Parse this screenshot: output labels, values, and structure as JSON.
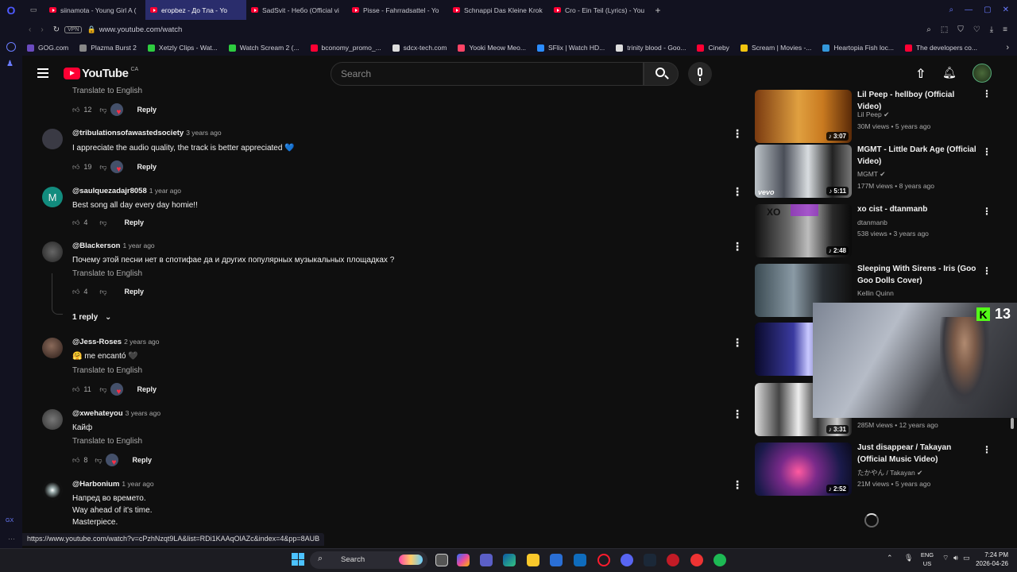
{
  "browser": {
    "tabs": [
      {
        "label": "siinamota - Young Girl A (",
        "active": false
      },
      {
        "label": "егорbez - До Тла - Yo",
        "active": true
      },
      {
        "label": "SadSvit - Небо (Official vi",
        "active": false
      },
      {
        "label": "Pisse - Fahrradsattel - Yo",
        "active": false
      },
      {
        "label": "Schnappi Das Kleine Krok",
        "active": false
      },
      {
        "label": "Cro - Ein Teil (Lyrics) - You",
        "active": false
      }
    ],
    "vpn": "VPN",
    "url": "www.youtube.com/watch",
    "bookmarks": [
      {
        "label": "GOG.com",
        "color": "#6b4bbf"
      },
      {
        "label": "Plazma Burst 2",
        "color": "#888"
      },
      {
        "label": "Xetzly Clips - Wat...",
        "color": "#2ecc40"
      },
      {
        "label": "Watch Scream 2 (...",
        "color": "#2ecc40"
      },
      {
        "label": "bconomy_promo_...",
        "color": "#ff0033"
      },
      {
        "label": "sdcx-tech.com",
        "color": "#ddd"
      },
      {
        "label": "Yooki Meow Meo...",
        "color": "#ff4466"
      },
      {
        "label": "SFlix | Watch HD...",
        "color": "#2b8cff"
      },
      {
        "label": "trinity blood - Goo...",
        "color": "#ddd"
      },
      {
        "label": "Cineby",
        "color": "#ff0033"
      },
      {
        "label": "Scream | Movies -...",
        "color": "#f1c40f"
      },
      {
        "label": "Heartopia Fish loc...",
        "color": "#3498db"
      },
      {
        "label": "The developers co...",
        "color": "#ff0033"
      }
    ],
    "status_url": "https://www.youtube.com/watch?v=cPzhNzqt9LA&list=RDi1KAAqOlAZc&index=4&pp=8AUB"
  },
  "youtube": {
    "logo": "YouTube",
    "region": "CA",
    "search_placeholder": "Search"
  },
  "comments": [
    {
      "trans": "Translate to English",
      "likes": "12",
      "reply": "Reply"
    },
    {
      "user": "@tribulationsofawastedsociety",
      "date": "3 years ago",
      "text": "I appreciate the audio quality, the track is better appreciated 💙",
      "likes": "19",
      "reply": "Reply"
    },
    {
      "user": "@saulquezadajr8058",
      "date": "1 year ago",
      "text": "Best song all day every day homie!!",
      "likes": "4",
      "reply": "Reply",
      "avatar_letter": "M"
    },
    {
      "user": "@Blackerson",
      "date": "1 year ago",
      "text": "Почему этой песни нет в спотифае да и других популярных музыкальных площадках ?",
      "trans": "Translate to English",
      "likes": "4",
      "reply": "Reply",
      "replies": "1 reply"
    },
    {
      "user": "@Jess-Roses",
      "date": "2 years ago",
      "text": "🤗 me encantó 🖤",
      "trans": "Translate to English",
      "likes": "11",
      "reply": "Reply"
    },
    {
      "user": "@xwehateyou",
      "date": "3 years ago",
      "text": "Кайф",
      "trans": "Translate to English",
      "likes": "8",
      "reply": "Reply"
    },
    {
      "user": "@Harbonium",
      "date": "1 year ago",
      "text1": "Напред во времето.",
      "text2": "Way ahead of it's time.",
      "text3": "Masterpiece."
    }
  ],
  "videos": [
    {
      "title": "Lil Peep - hellboy (Official Video)",
      "channel": "Lil Peep",
      "meta": "30M views • 5 years ago",
      "duration": "3:07"
    },
    {
      "title": "MGMT - Little Dark Age (Official Video)",
      "channel": "MGMT",
      "meta": "177M views • 8 years ago",
      "duration": "5:11"
    },
    {
      "title": "xo cist - dtanmanb",
      "channel": "dtanmanb",
      "meta": "538 views • 3 years ago",
      "duration": "2:48"
    },
    {
      "title": "Sleeping With Sirens - Iris (Goo Goo Dolls Cover)",
      "channel": "Kellin Quinn",
      "meta": "",
      "duration": ""
    },
    {
      "title": "",
      "channel": "",
      "meta": "285M views • 12 years ago",
      "duration": "3:31"
    },
    {
      "title": "Just disappear / Takayan (Official Music Video)",
      "channel": "たかやん / Takayan",
      "meta": "21M views • 5 years ago",
      "duration": "2:52"
    }
  ],
  "overlay_count": "13",
  "taskbar": {
    "search": "Search",
    "lang1": "ENG",
    "lang2": "US",
    "time": "7:24 PM",
    "date": "2026-04-26"
  },
  "colors": {
    "accent": "#ff0033",
    "tab_active": "#2a2d6c",
    "heart": "#ff2e45"
  }
}
